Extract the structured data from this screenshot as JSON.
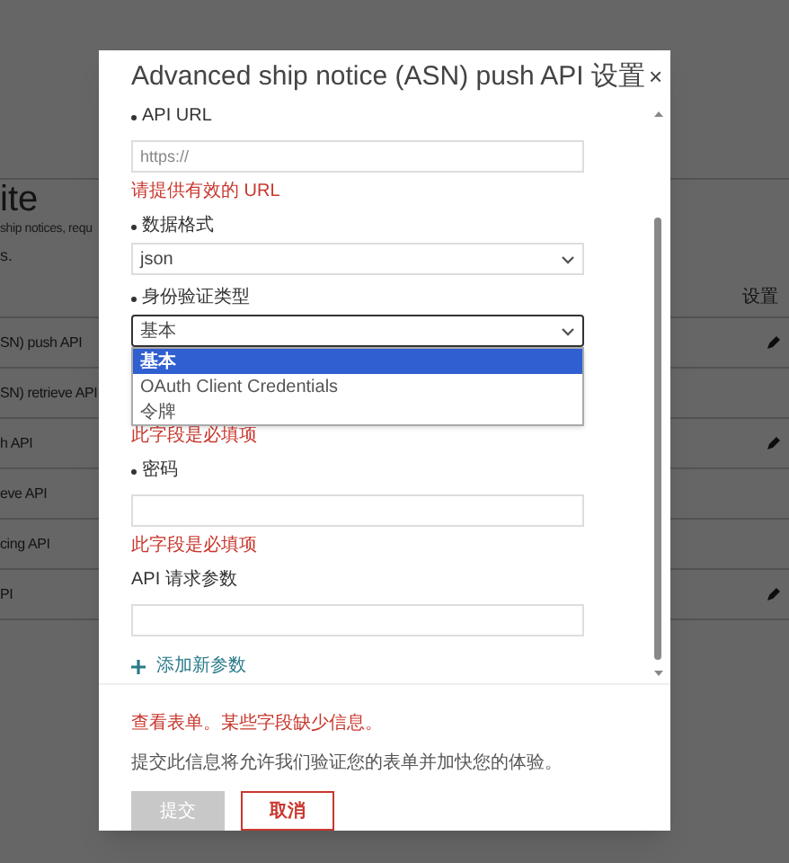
{
  "background": {
    "title": "ite",
    "description": "ship notices, requ",
    "note": "s.",
    "column_header": "设置",
    "rows": [
      {
        "name": "SN) push API",
        "editable": true
      },
      {
        "name": "SN) retrieve API",
        "editable": false
      },
      {
        "name": "h API",
        "editable": true
      },
      {
        "name": "eve API",
        "editable": false
      },
      {
        "name": "cing API",
        "editable": false
      },
      {
        "name": "PI",
        "editable": true
      }
    ]
  },
  "dialog": {
    "title": "Advanced ship notice (ASN) push API 设置",
    "close": "×",
    "fields": [
      {
        "kind": "text",
        "required": true,
        "label": "API URL",
        "placeholder": "https://",
        "error": "请提供有效的 URL"
      },
      {
        "kind": "select",
        "required": true,
        "label": "数据格式",
        "value": "json"
      },
      {
        "kind": "select",
        "required": true,
        "label": "身份验证类型",
        "value": "基本",
        "expanded": true,
        "options": [
          {
            "label": "基本",
            "selected": true
          },
          {
            "label": "OAuth Client Credentials",
            "selected": false
          },
          {
            "label": "令牌",
            "selected": false
          }
        ]
      },
      {
        "kind": "covered",
        "error": "此字段是必填项"
      },
      {
        "kind": "text",
        "required": true,
        "label": "密码",
        "error": "此字段是必填项"
      },
      {
        "kind": "text",
        "required": false,
        "label": "API 请求参数"
      }
    ],
    "add_link": "添加新参数",
    "form_error": "查看表单。某些字段缺少信息。",
    "info": "提交此信息将允许我们验证您的表单并加快您的体验。",
    "buttons": [
      {
        "label": "提交",
        "kind": "primary",
        "disabled": true
      },
      {
        "label": "取消",
        "kind": "secondary",
        "disabled": false
      }
    ]
  }
}
